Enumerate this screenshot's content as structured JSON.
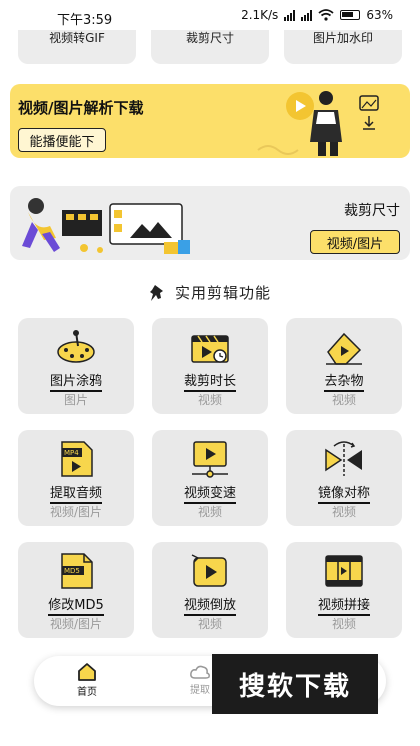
{
  "status_bar": {
    "time": "下午3:59",
    "network_speed": "2.1K/s",
    "battery": "63"
  },
  "top_row": [
    "视频转GIF",
    "裁剪尺寸",
    "图片加水印"
  ],
  "banner_parse": {
    "title": "视频/图片解析下载",
    "button": "能播便能下",
    "bg_color": "#fcdf6a"
  },
  "banner_crop": {
    "title": "裁剪尺寸",
    "button": "视频/图片",
    "bg_color": "#ededed"
  },
  "section": {
    "title": "实用剪辑功能",
    "icon": "pin-icon"
  },
  "tools": [
    {
      "name": "图片涂鸦",
      "type": "图片",
      "icon": "palette-icon"
    },
    {
      "name": "裁剪时长",
      "type": "视频",
      "icon": "clapper-clock-icon"
    },
    {
      "name": "去杂物",
      "type": "视频",
      "icon": "eraser-icon"
    },
    {
      "name": "提取音频",
      "type": "视频/图片",
      "icon": "mp4-file-icon"
    },
    {
      "name": "视频变速",
      "type": "视频",
      "icon": "speed-screen-icon"
    },
    {
      "name": "镜像对称",
      "type": "视频",
      "icon": "mirror-icon"
    },
    {
      "name": "修改MD5",
      "type": "视频/图片",
      "icon": "md5-file-icon"
    },
    {
      "name": "视频倒放",
      "type": "视频",
      "icon": "reverse-play-icon"
    },
    {
      "name": "视频拼接",
      "type": "视频",
      "icon": "film-grid-icon"
    }
  ],
  "bottom_nav": {
    "home": "首页",
    "extract": "提取"
  },
  "watermark": "搜软下载",
  "colors": {
    "accent": "#fcdf6a",
    "tile_bg": "#e9e9e9",
    "muted_text": "#9a9a9a"
  }
}
